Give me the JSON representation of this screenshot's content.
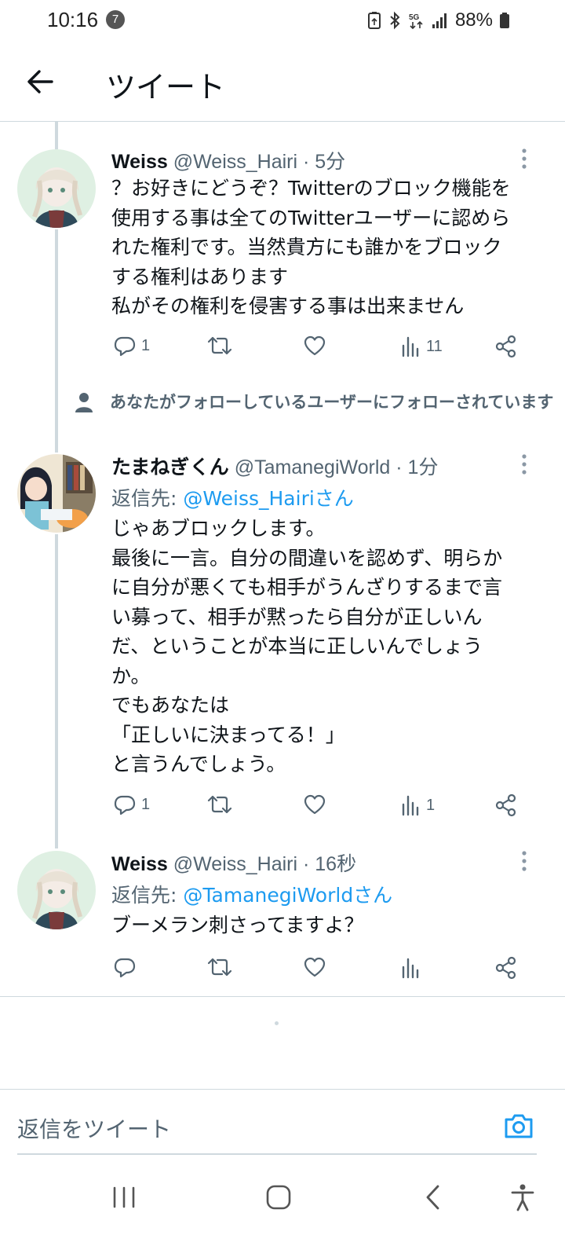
{
  "status_bar": {
    "time": "10:16",
    "notification_count": "7",
    "battery": "88%"
  },
  "header": {
    "title": "ツイート"
  },
  "tweets": [
    {
      "name": "Weiss",
      "handle": "@Weiss_Hairi",
      "time": "· 5分",
      "text": "？お好きにどうぞ？Twitterのブロック機能を\n使用する事は全てのTwitterユーザーに認めら\nれた権利です。当然貴方にも誰かをブロック\nする権利はあります\n私がその権利を侵害する事は出来ません",
      "reply_count": "1",
      "retweet_count": "",
      "like_count": "",
      "view_count": "11"
    },
    {
      "social_context": "あなたがフォローしているユーザーにフォローされています",
      "name": "たまねぎくん",
      "handle": "@TamanegiWorld",
      "time": "· 1分",
      "reply_to_prefix": "返信先: ",
      "reply_to_mention": "@Weiss_Hairiさん",
      "text": "じゃあブロックします。\n最後に一言。自分の間違いを認めず、明らか\nに自分が悪くても相手がうんざりするまで言\nい募って、相手が黙ったら自分が正しいん\nだ、ということが本当に正しいんでしょう\nか。\nでもあなたは\n「正しいに決まってる！」\nと言うんでしょう。",
      "reply_count": "1",
      "retweet_count": "",
      "like_count": "",
      "view_count": "1"
    },
    {
      "name": "Weiss",
      "handle": "@Weiss_Hairi",
      "time": "· 16秒",
      "reply_to_prefix": "返信先: ",
      "reply_to_mention": "@TamanegiWorldさん",
      "text": "ブーメラン刺さってますよ？",
      "reply_count": "",
      "retweet_count": "",
      "like_count": "",
      "view_count": ""
    }
  ],
  "composer": {
    "placeholder": "返信をツイート"
  },
  "icons": {
    "back": "arrow-left-icon",
    "more": "more-vertical-icon",
    "reply": "reply-icon",
    "retweet": "retweet-icon",
    "like": "heart-icon",
    "views": "views-icon",
    "share": "share-icon",
    "camera": "camera-icon",
    "person": "person-icon"
  },
  "colors": {
    "accent": "#1d9bf0",
    "text_secondary": "#536471",
    "divider": "#cfd9de"
  }
}
